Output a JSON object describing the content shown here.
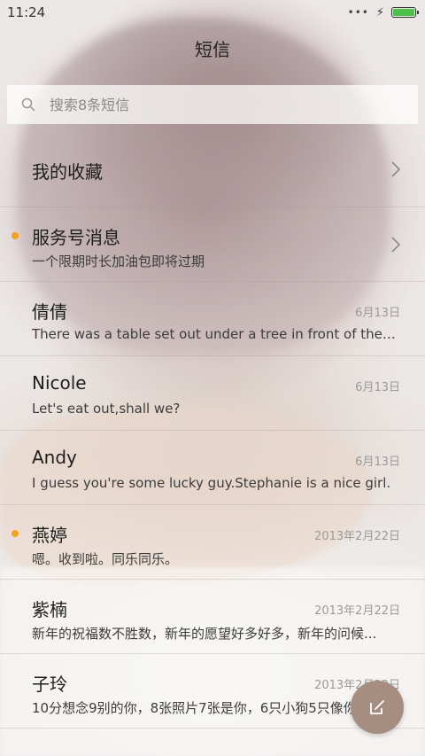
{
  "status_bar": {
    "time": "11:24",
    "battery_level": 1.0,
    "battery_color": "#4cc24c"
  },
  "header": {
    "title": "短信"
  },
  "search": {
    "placeholder": "搜索8条短信",
    "icon": "search-icon"
  },
  "list": {
    "items": [
      {
        "name": "我的收藏",
        "snippet": "",
        "date": "",
        "unread": false,
        "chevron": true
      },
      {
        "name": "服务号消息",
        "snippet": "一个限期时长加油包即将过期",
        "date": "",
        "unread": true,
        "chevron": true
      },
      {
        "name": "倩倩",
        "snippet": "There was a table set out under a tree in front of the ho...",
        "date": "6月13日",
        "unread": false,
        "chevron": false
      },
      {
        "name": "Nicole",
        "snippet": "Let's eat out,shall we?",
        "date": "6月13日",
        "unread": false,
        "chevron": false
      },
      {
        "name": "Andy",
        "snippet": "I guess you're some lucky guy.Stephanie is a nice girl.",
        "date": "6月13日",
        "unread": false,
        "chevron": false
      },
      {
        "name": "燕婷",
        "snippet": "嗯。收到啦。同乐同乐。",
        "date": "2013年2月22日",
        "unread": true,
        "chevron": false
      },
      {
        "name": "紫楠",
        "snippet": "新年的祝福数不胜数，新年的愿望好多好多，新年的问候...",
        "date": "2013年2月22日",
        "unread": false,
        "chevron": false
      },
      {
        "name": "子玲",
        "snippet": "10分想念9别的你，8张照片7张是你，6只小狗5只像你...",
        "date": "2013年2月22日",
        "unread": false,
        "chevron": false
      }
    ]
  },
  "fab": {
    "icon": "compose-icon",
    "color": "#a58e80"
  },
  "colors": {
    "unread_dot": "#f4a021"
  }
}
